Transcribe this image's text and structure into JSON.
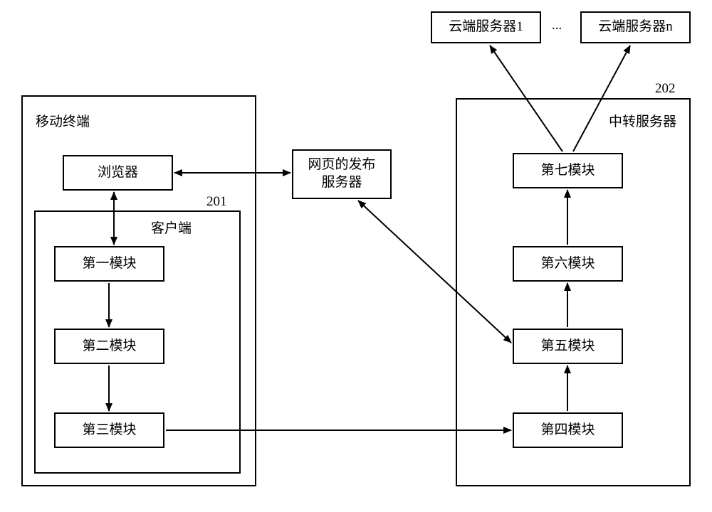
{
  "cloud": {
    "server1": "云端服务器1",
    "ellipsis": "...",
    "serverN": "云端服务器n"
  },
  "mobileTerminal": {
    "label": "移动终端"
  },
  "browser": "浏览器",
  "client": {
    "label": "客户端",
    "id": "201",
    "m1": "第一模块",
    "m2": "第二模块",
    "m3": "第三模块"
  },
  "publishServer": "网页的发布\n服务器",
  "relayServer": {
    "label": "中转服务器",
    "id": "202",
    "m4": "第四模块",
    "m5": "第五模块",
    "m6": "第六模块",
    "m7": "第七模块"
  }
}
